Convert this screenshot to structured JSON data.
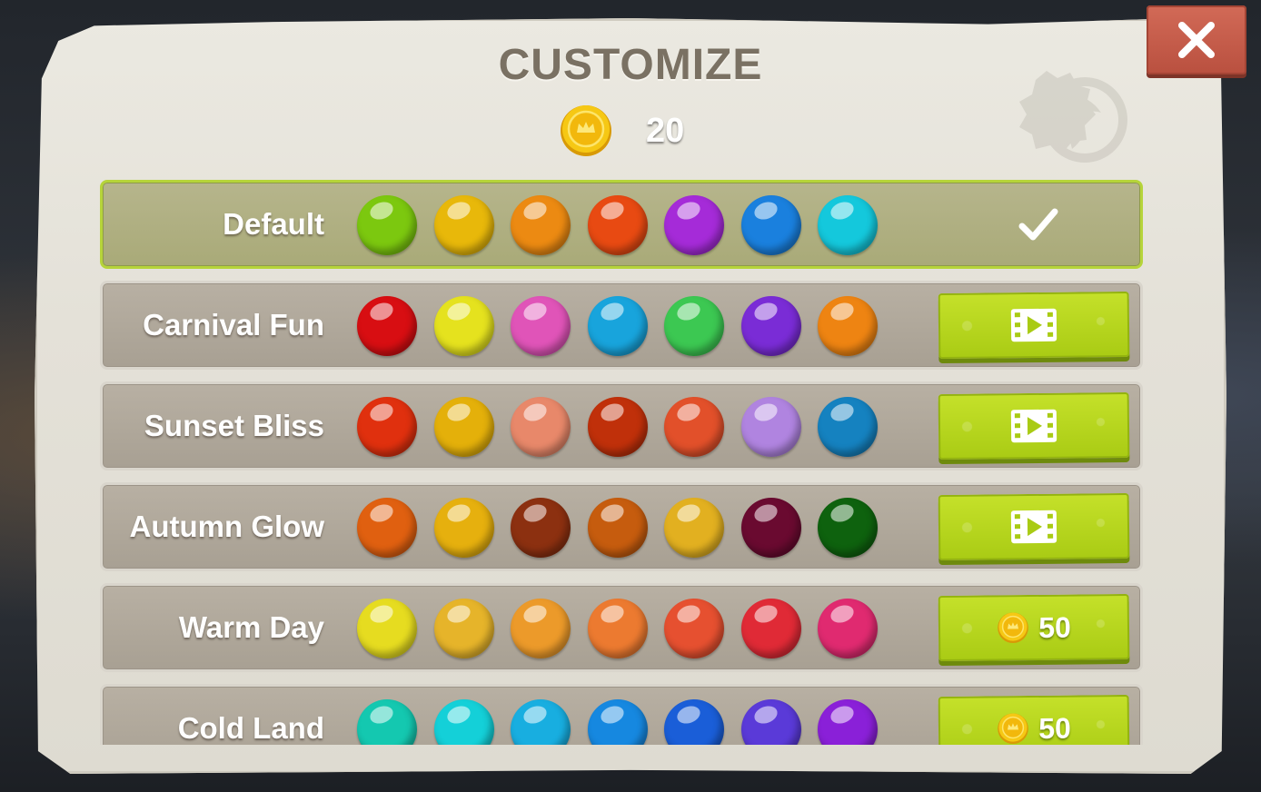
{
  "title": "CUSTOMIZE",
  "coins": {
    "count": "20"
  },
  "close_icon": "close-icon",
  "coin_icon": "gold-coin-icon",
  "themes": [
    {
      "name": "Default",
      "selected": true,
      "action": "selected",
      "colors": [
        "#7cc80f",
        "#e8b80a",
        "#ec8a12",
        "#e84a12",
        "#a52bd8",
        "#1a80de",
        "#14c8dc"
      ]
    },
    {
      "name": "Carnival Fun",
      "selected": false,
      "action": "video",
      "colors": [
        "#d80e12",
        "#e5e21e",
        "#e054b8",
        "#18a4dc",
        "#3cc852",
        "#7a2cd6",
        "#ee8412"
      ]
    },
    {
      "name": "Sunset Bliss",
      "selected": false,
      "action": "video",
      "colors": [
        "#e0300e",
        "#e4b00a",
        "#e8886a",
        "#c0300a",
        "#e2502a",
        "#b084e0",
        "#1582c0"
      ]
    },
    {
      "name": "Autumn Glow",
      "selected": false,
      "action": "video",
      "colors": [
        "#e06010",
        "#e6b00e",
        "#8c3010",
        "#c65c0e",
        "#e2b020",
        "#6a0a30",
        "#0e620e"
      ]
    },
    {
      "name": "Warm Day",
      "selected": false,
      "action": "coins",
      "price": "50",
      "colors": [
        "#e6dc20",
        "#e6b42a",
        "#ec9a2a",
        "#ec7a30",
        "#e65030",
        "#e02a36",
        "#e02a70"
      ]
    },
    {
      "name": "Cold Land",
      "selected": false,
      "action": "coins",
      "price": "50",
      "colors": [
        "#14c8b0",
        "#14d0d8",
        "#18aee0",
        "#1688e0",
        "#1a5ed8",
        "#5a3ad8",
        "#8a20d8"
      ]
    }
  ],
  "colors": {
    "accent": "#b6d43a",
    "button": "#b5d41e",
    "close": "#c45c4a"
  }
}
